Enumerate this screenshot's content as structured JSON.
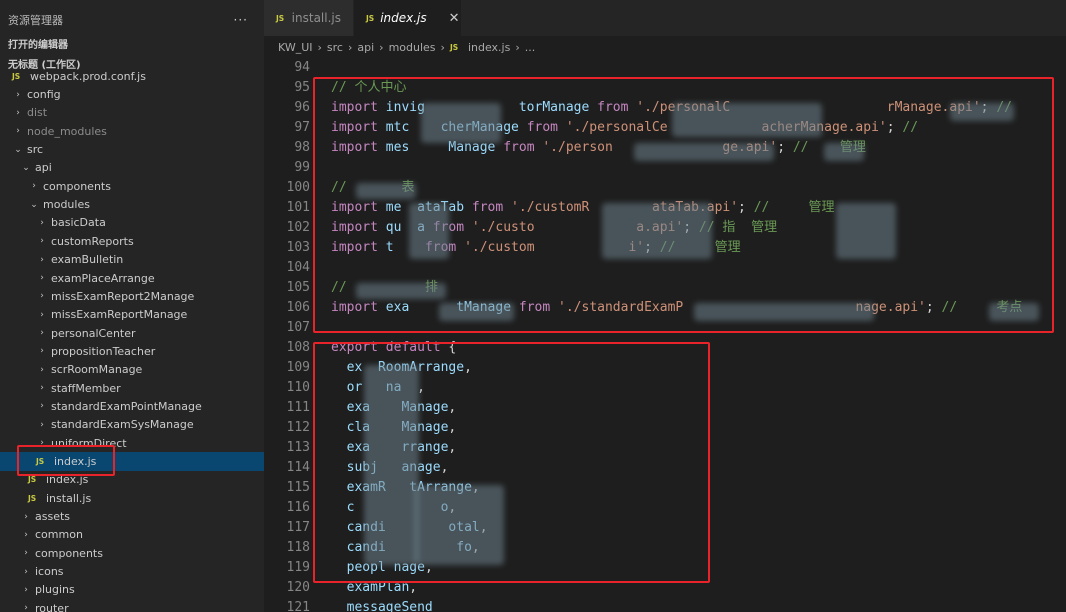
{
  "sidebar": {
    "title": "资源管理器",
    "more": "···",
    "open_editors": "打开的编辑器",
    "workspace": "无标题 (工作区)",
    "items": [
      {
        "label": "webpack.prod.conf.js",
        "indent": 1,
        "kind": "js",
        "dim": false
      },
      {
        "label": "config",
        "indent": 1,
        "kind": "folder",
        "open": false,
        "dim": false
      },
      {
        "label": "dist",
        "indent": 1,
        "kind": "folder",
        "open": false,
        "dim": true
      },
      {
        "label": "node_modules",
        "indent": 1,
        "kind": "folder",
        "open": false,
        "dim": true
      },
      {
        "label": "src",
        "indent": 1,
        "kind": "folder",
        "open": true,
        "dim": false
      },
      {
        "label": "api",
        "indent": 2,
        "kind": "folder",
        "open": true,
        "dim": false
      },
      {
        "label": "components",
        "indent": 3,
        "kind": "folder",
        "open": false,
        "dim": false
      },
      {
        "label": "modules",
        "indent": 3,
        "kind": "folder",
        "open": true,
        "dim": false
      },
      {
        "label": "basicData",
        "indent": 4,
        "kind": "folder",
        "open": false,
        "dim": false
      },
      {
        "label": "customReports",
        "indent": 4,
        "kind": "folder",
        "open": false,
        "dim": false
      },
      {
        "label": "examBulletin",
        "indent": 4,
        "kind": "folder",
        "open": false,
        "dim": false
      },
      {
        "label": "examPlaceArrange",
        "indent": 4,
        "kind": "folder",
        "open": false,
        "dim": false
      },
      {
        "label": "missExamReport2Manage",
        "indent": 4,
        "kind": "folder",
        "open": false,
        "dim": false
      },
      {
        "label": "missExamReportManage",
        "indent": 4,
        "kind": "folder",
        "open": false,
        "dim": false
      },
      {
        "label": "personalCenter",
        "indent": 4,
        "kind": "folder",
        "open": false,
        "dim": false
      },
      {
        "label": "propositionTeacher",
        "indent": 4,
        "kind": "folder",
        "open": false,
        "dim": false
      },
      {
        "label": "scrRoomManage",
        "indent": 4,
        "kind": "folder",
        "open": false,
        "dim": false
      },
      {
        "label": "staffMember",
        "indent": 4,
        "kind": "folder",
        "open": false,
        "dim": false
      },
      {
        "label": "standardExamPointManage",
        "indent": 4,
        "kind": "folder",
        "open": false,
        "dim": false
      },
      {
        "label": "standardExamSysManage",
        "indent": 4,
        "kind": "folder",
        "open": false,
        "dim": false
      },
      {
        "label": "uniformDirect",
        "indent": 4,
        "kind": "folder",
        "open": false,
        "dim": false
      },
      {
        "label": "index.js",
        "indent": 4,
        "kind": "js",
        "selected": true,
        "dim": false
      },
      {
        "label": "index.js",
        "indent": 3,
        "kind": "js",
        "dim": false
      },
      {
        "label": "install.js",
        "indent": 3,
        "kind": "js",
        "dim": false
      },
      {
        "label": "assets",
        "indent": 2,
        "kind": "folder",
        "open": false,
        "dim": false
      },
      {
        "label": "common",
        "indent": 2,
        "kind": "folder",
        "open": false,
        "dim": false
      },
      {
        "label": "components",
        "indent": 2,
        "kind": "folder",
        "open": false,
        "dim": false
      },
      {
        "label": "icons",
        "indent": 2,
        "kind": "folder",
        "open": false,
        "dim": false
      },
      {
        "label": "plugins",
        "indent": 2,
        "kind": "folder",
        "open": false,
        "dim": false
      },
      {
        "label": "router",
        "indent": 2,
        "kind": "folder",
        "open": false,
        "dim": false
      }
    ]
  },
  "tabs": [
    {
      "label": "install.js",
      "active": false,
      "badge": "JS"
    },
    {
      "label": "index.js",
      "active": true,
      "badge": "JS",
      "close": "✕"
    }
  ],
  "breadcrumb": [
    "KW_UI",
    "src",
    "api",
    "modules",
    "index.js",
    "..."
  ],
  "code": {
    "lines": [
      {
        "n": "94",
        "parts": []
      },
      {
        "n": "95",
        "parts": [
          [
            "cm",
            "// 个人中心"
          ]
        ]
      },
      {
        "n": "96",
        "parts": [
          [
            "kw",
            "import "
          ],
          [
            "id",
            "invig"
          ],
          [
            "id",
            "            "
          ],
          [
            "id",
            "torManage "
          ],
          [
            "kw",
            "from "
          ],
          [
            "str",
            "'./personalC"
          ],
          [
            "str",
            "                    "
          ],
          [
            "str",
            "rManage.api'"
          ],
          [
            "pn",
            "; "
          ],
          [
            "cm",
            "// "
          ],
          [
            "cm",
            "      "
          ],
          [
            "cm",
            "管理"
          ]
        ]
      },
      {
        "n": "97",
        "parts": [
          [
            "kw",
            "import "
          ],
          [
            "id",
            "mtc"
          ],
          [
            "id",
            "    "
          ],
          [
            "id",
            "cherManage "
          ],
          [
            "kw",
            "from "
          ],
          [
            "str",
            "'./personalCe"
          ],
          [
            "str",
            "            "
          ],
          [
            "str",
            "acherManage.api'"
          ],
          [
            "pn",
            "; "
          ],
          [
            "cm",
            "// "
          ]
        ]
      },
      {
        "n": "98",
        "parts": [
          [
            "kw",
            "import "
          ],
          [
            "id",
            "mes"
          ],
          [
            "id",
            "     "
          ],
          [
            "id",
            "Manage "
          ],
          [
            "kw",
            "from "
          ],
          [
            "str",
            "'./person"
          ],
          [
            "str",
            "              "
          ],
          [
            "str",
            "ge.api'"
          ],
          [
            "pn",
            "; "
          ],
          [
            "cm",
            "// "
          ],
          [
            "cm",
            "   "
          ],
          [
            "cm",
            "管理"
          ]
        ]
      },
      {
        "n": "99",
        "parts": []
      },
      {
        "n": "100",
        "parts": [
          [
            "cm",
            "// "
          ],
          [
            "cm",
            "      "
          ],
          [
            "cm",
            "表"
          ]
        ]
      },
      {
        "n": "101",
        "parts": [
          [
            "kw",
            "import "
          ],
          [
            "id",
            "me"
          ],
          [
            "id",
            "  "
          ],
          [
            "id",
            "ataTab "
          ],
          [
            "kw",
            "from "
          ],
          [
            "str",
            "'./customR"
          ],
          [
            "str",
            "        "
          ],
          [
            "str",
            "ataTab.api'"
          ],
          [
            "pn",
            "; "
          ],
          [
            "cm",
            "// "
          ],
          [
            "cm",
            "    "
          ],
          [
            "cm",
            "管理"
          ]
        ]
      },
      {
        "n": "102",
        "parts": [
          [
            "kw",
            "import "
          ],
          [
            "id",
            "qu"
          ],
          [
            "id",
            "  "
          ],
          [
            "id",
            "a "
          ],
          [
            "kw",
            "from "
          ],
          [
            "str",
            "'./custo"
          ],
          [
            "str",
            "             "
          ],
          [
            "str",
            "a.api'"
          ],
          [
            "pn",
            "; "
          ],
          [
            "cm",
            "// "
          ],
          [
            "cm",
            "指"
          ],
          [
            "cm",
            "  "
          ],
          [
            "cm",
            "管理"
          ]
        ]
      },
      {
        "n": "103",
        "parts": [
          [
            "kw",
            "import "
          ],
          [
            "id",
            "t"
          ],
          [
            "id",
            "   "
          ],
          [
            "id",
            " "
          ],
          [
            "kw",
            "from "
          ],
          [
            "str",
            "'./custom"
          ],
          [
            "str",
            "            "
          ],
          [
            "str",
            "i'"
          ],
          [
            "pn",
            "; "
          ],
          [
            "cm",
            "// "
          ],
          [
            "cm",
            "    "
          ],
          [
            "cm",
            "管理"
          ]
        ]
      },
      {
        "n": "104",
        "parts": []
      },
      {
        "n": "105",
        "parts": [
          [
            "cm",
            "// "
          ],
          [
            "cm",
            "         "
          ],
          [
            "cm",
            "排"
          ]
        ]
      },
      {
        "n": "106",
        "parts": [
          [
            "kw",
            "import "
          ],
          [
            "id",
            "exa"
          ],
          [
            "id",
            "      "
          ],
          [
            "id",
            "tManage "
          ],
          [
            "kw",
            "from "
          ],
          [
            "str",
            "'./standardExamP"
          ],
          [
            "str",
            "                      "
          ],
          [
            "str",
            "nage.api'"
          ],
          [
            "pn",
            "; "
          ],
          [
            "cm",
            "// "
          ],
          [
            "cm",
            "    "
          ],
          [
            "cm",
            "考点"
          ]
        ]
      },
      {
        "n": "107",
        "parts": []
      },
      {
        "n": "108",
        "parts": [
          [
            "kw",
            "export "
          ],
          [
            "kw",
            "default "
          ],
          [
            "pn",
            "{"
          ]
        ]
      },
      {
        "n": "109",
        "parts": [
          [
            "ind",
            "  "
          ],
          [
            "id",
            "ex"
          ],
          [
            "id",
            "  "
          ],
          [
            "id",
            "RoomArrange"
          ],
          [
            "pn",
            ","
          ]
        ]
      },
      {
        "n": "110",
        "parts": [
          [
            "ind",
            "  "
          ],
          [
            "id",
            "or"
          ],
          [
            "id",
            "   "
          ],
          [
            "id",
            "na"
          ],
          [
            "id",
            "  "
          ],
          [
            "pn",
            ","
          ]
        ]
      },
      {
        "n": "111",
        "parts": [
          [
            "ind",
            "  "
          ],
          [
            "id",
            "exa"
          ],
          [
            "id",
            "    "
          ],
          [
            "id",
            "Manage"
          ],
          [
            "pn",
            ","
          ]
        ]
      },
      {
        "n": "112",
        "parts": [
          [
            "ind",
            "  "
          ],
          [
            "id",
            "cla"
          ],
          [
            "id",
            "    "
          ],
          [
            "id",
            "Manage"
          ],
          [
            "pn",
            ","
          ]
        ]
      },
      {
        "n": "113",
        "parts": [
          [
            "ind",
            "  "
          ],
          [
            "id",
            "exa"
          ],
          [
            "id",
            "    "
          ],
          [
            "id",
            "rrange"
          ],
          [
            "pn",
            ","
          ]
        ]
      },
      {
        "n": "114",
        "parts": [
          [
            "ind",
            "  "
          ],
          [
            "id",
            "subj"
          ],
          [
            "id",
            "   "
          ],
          [
            "id",
            "anage"
          ],
          [
            "pn",
            ","
          ]
        ]
      },
      {
        "n": "115",
        "parts": [
          [
            "ind",
            "  "
          ],
          [
            "id",
            "examR"
          ],
          [
            "id",
            "   "
          ],
          [
            "id",
            "tArrange"
          ],
          [
            "pn",
            ","
          ]
        ]
      },
      {
        "n": "116",
        "parts": [
          [
            "ind",
            "  "
          ],
          [
            "id",
            "c"
          ],
          [
            "id",
            "           "
          ],
          [
            "id",
            "o"
          ],
          [
            "pn",
            ","
          ]
        ]
      },
      {
        "n": "117",
        "parts": [
          [
            "ind",
            "  "
          ],
          [
            "id",
            "candi"
          ],
          [
            "id",
            "        "
          ],
          [
            "id",
            "otal"
          ],
          [
            "pn",
            ","
          ]
        ]
      },
      {
        "n": "118",
        "parts": [
          [
            "ind",
            "  "
          ],
          [
            "id",
            "candi"
          ],
          [
            "id",
            "         "
          ],
          [
            "id",
            "fo"
          ],
          [
            "pn",
            ","
          ]
        ]
      },
      {
        "n": "119",
        "parts": [
          [
            "ind",
            "  "
          ],
          [
            "id",
            "peopl"
          ],
          [
            "id",
            " "
          ],
          [
            "id",
            "nage"
          ],
          [
            "pn",
            ","
          ]
        ]
      },
      {
        "n": "120",
        "parts": [
          [
            "ind",
            "  "
          ],
          [
            "id",
            "examPlan"
          ],
          [
            "pn",
            ","
          ]
        ]
      },
      {
        "n": "121",
        "parts": [
          [
            "ind",
            "  "
          ],
          [
            "id",
            "messageSend"
          ]
        ]
      }
    ]
  },
  "colors": {
    "highlight_box": "#e8242a",
    "selection": "#094771",
    "sidebar_bg": "#252526",
    "editor_bg": "#1e1e1e"
  }
}
